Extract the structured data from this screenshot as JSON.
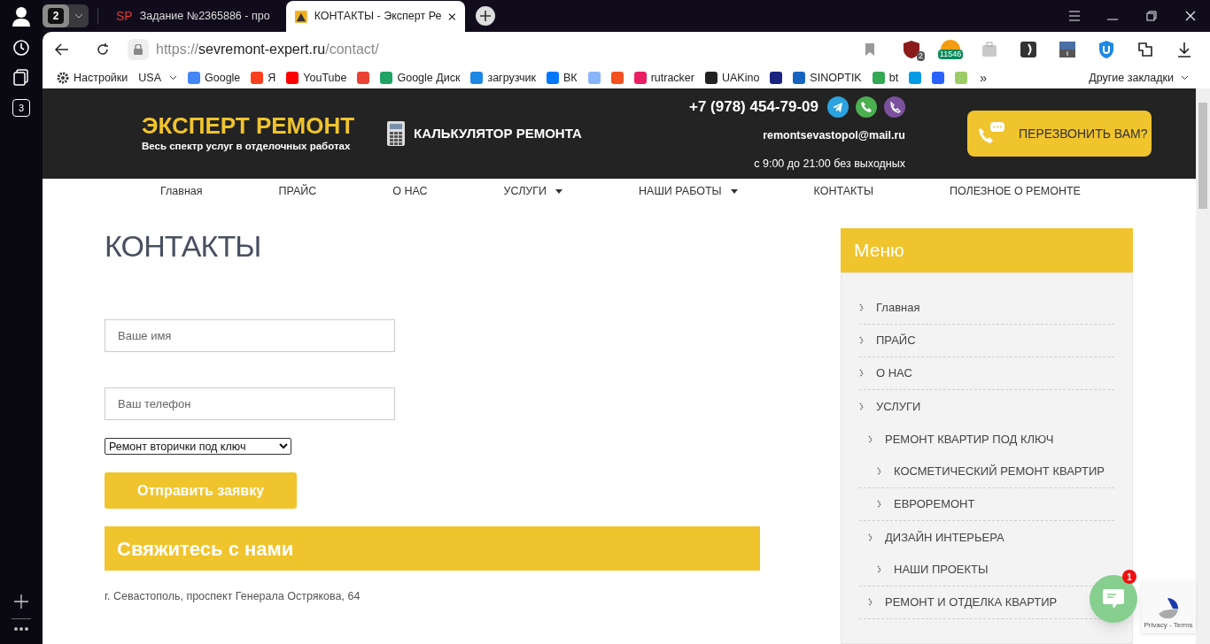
{
  "browser": {
    "tab_group_count": "2",
    "side_badge": "3",
    "tabs": [
      {
        "title": "Задание №2365886 - про",
        "favicon": "SP",
        "selected": false
      },
      {
        "title": "КОНТАКТЫ - Эксперт Ре",
        "selected": true
      }
    ],
    "url": {
      "scheme": "https://",
      "host": "sevremont-expert.ru",
      "path": "/contact/"
    },
    "extensions": [
      {
        "kind": "shield",
        "badge": "2"
      },
      {
        "kind": "counter",
        "badge": "11546"
      },
      {
        "kind": "bag"
      },
      {
        "kind": "dark"
      },
      {
        "kind": "media"
      },
      {
        "kind": "u"
      },
      {
        "kind": "puzzle"
      },
      {
        "kind": "download"
      }
    ],
    "bookmarks": [
      {
        "kind": "gear",
        "label": "Настройки"
      },
      {
        "kind": "dropdown",
        "label": "USA"
      },
      {
        "kind": "fav",
        "color": "#4285f4",
        "label": "Google"
      },
      {
        "kind": "fav",
        "color": "#fc3f1d",
        "label": "Я"
      },
      {
        "kind": "fav",
        "color": "#ff0000",
        "label": "YouTube"
      },
      {
        "kind": "fav",
        "color": "#ea4335"
      },
      {
        "kind": "fav",
        "color": "#1fa463",
        "label": "Google Диск"
      },
      {
        "kind": "fav",
        "color": "#1e88e5",
        "label": "загрузчик"
      },
      {
        "kind": "fav",
        "color": "#0077ff",
        "label": "ВК"
      },
      {
        "kind": "fav",
        "color": "#8ab4f8"
      },
      {
        "kind": "fav",
        "color": "#f4511e"
      },
      {
        "kind": "fav",
        "color": "#e91e63",
        "label": "rutracker"
      },
      {
        "kind": "fav",
        "color": "#222222",
        "label": "UAKino"
      },
      {
        "kind": "fav",
        "color": "#1a237e"
      },
      {
        "kind": "fav",
        "color": "#1565c0",
        "label": "SINOPTIK"
      },
      {
        "kind": "fav",
        "color": "#34a853",
        "label": "bt"
      },
      {
        "kind": "fav",
        "color": "#039be5"
      },
      {
        "kind": "fav",
        "color": "#2962ff"
      },
      {
        "kind": "fav",
        "color": "#9ccc65"
      }
    ],
    "more": "»",
    "other_bookmarks": "Другие закладки"
  },
  "site": {
    "logo_title": "ЭКСПЕРТ РЕМОНТ",
    "logo_subtitle": "Весь спектр услуг в отделочных работах",
    "calculator": "КАЛЬКУЛЯТОР РЕМОНТА",
    "phone": "+7 (978) 454-79-09",
    "email": "remontsevastopol@mail.ru",
    "hours": "с 9:00 до 21:00 без выходных",
    "callback": "ПЕРЕЗВОНИТЬ ВАМ?",
    "nav": [
      {
        "label": "Главная",
        "dropdown": false
      },
      {
        "label": "ПРАЙС",
        "dropdown": false
      },
      {
        "label": "О НАС",
        "dropdown": false
      },
      {
        "label": "УСЛУГИ",
        "dropdown": true
      },
      {
        "label": "НАШИ РАБОТЫ",
        "dropdown": true
      },
      {
        "label": "КОНТАКТЫ",
        "dropdown": false
      },
      {
        "label": "ПОЛЕЗНОЕ О РЕМОНТЕ",
        "dropdown": false
      }
    ],
    "page_title": "КОНТАКТЫ",
    "form": {
      "name": {
        "placeholder": "Ваше имя"
      },
      "phone": {
        "placeholder": "Ваш телефон"
      },
      "service": "Ремонт вторички под ключ",
      "submit": "Отправить заявку"
    },
    "contact_heading": "Свяжитесь с нами",
    "address": "г. Севастополь, проспект Генерала Острякова, 64",
    "sidebar": {
      "title": "Меню",
      "items": [
        {
          "label": "Главная"
        },
        {
          "label": "ПРАЙС"
        },
        {
          "label": "О НАС"
        },
        {
          "label": "УСЛУГИ",
          "children": [
            {
              "label": "РЕМОНТ КВАРТИР ПОД КЛЮЧ",
              "children": [
                {
                  "label": "КОСМЕТИЧЕСКИЙ РЕМОНТ КВАРТИР"
                },
                {
                  "label": "ЕВРОРЕМОНТ"
                }
              ]
            },
            {
              "label": "ДИЗАЙН ИНТЕРЬЕРА",
              "children": [
                {
                  "label": "НАШИ ПРОЕКТЫ"
                }
              ]
            },
            {
              "label": "РЕМОНТ И ОТДЕЛКА КВАРТИР"
            }
          ]
        }
      ]
    },
    "chat_badge": "1",
    "recaptcha": "Privacy - Terms"
  }
}
